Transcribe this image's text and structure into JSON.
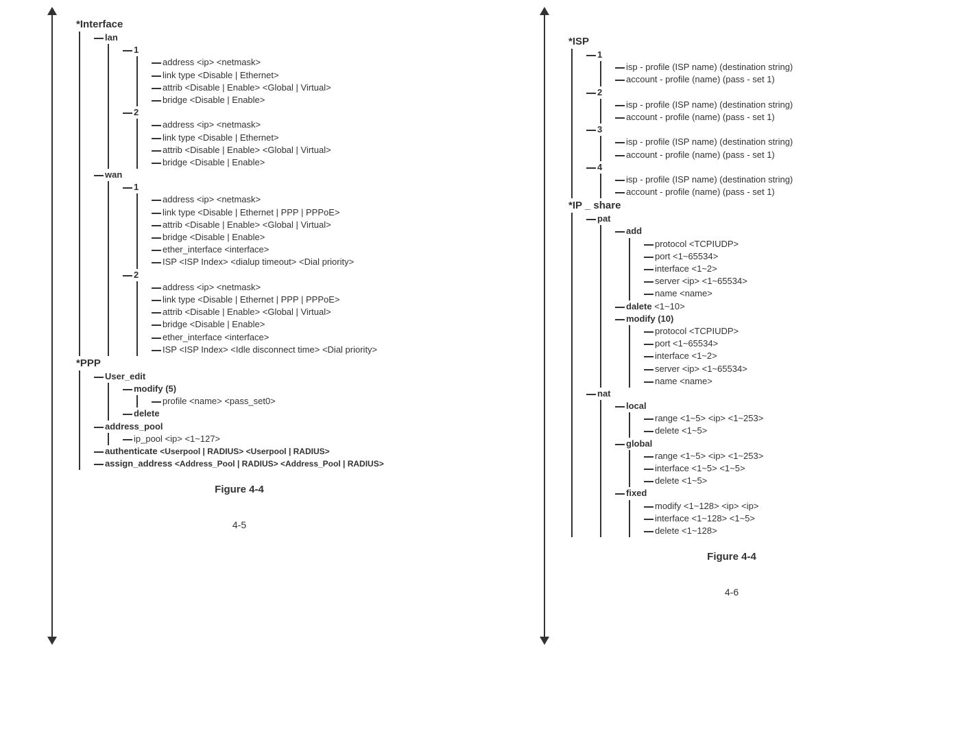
{
  "left": {
    "interface": {
      "label": "*Interface",
      "lan": {
        "label": "lan",
        "n1": {
          "label": "1",
          "a": "address <ip> <netmask>",
          "b": "link type <Disable | Ethernet>",
          "c": "attrib <Disable | Enable> <Global | Virtual>",
          "d": "bridge <Disable | Enable>"
        },
        "n2": {
          "label": "2",
          "a": "address <ip> <netmask>",
          "b": "link type <Disable | Ethernet>",
          "c": "attrib <Disable | Enable> <Global | Virtual>",
          "d": "bridge <Disable | Enable>"
        }
      },
      "wan": {
        "label": "wan",
        "n1": {
          "label": "1",
          "a": "address <ip> <netmask>",
          "b": "link type <Disable | Ethernet | PPP | PPPoE>",
          "c": "attrib <Disable | Enable> <Global | Virtual>",
          "d": "bridge <Disable | Enable>",
          "e": "ether_interface <interface>",
          "f": "ISP <ISP Index> <dialup timeout> <Dial priority>"
        },
        "n2": {
          "label": "2",
          "a": "address <ip> <netmask>",
          "b": "link type <Disable | Ethernet | PPP | PPPoE>",
          "c": "attrib <Disable | Enable> <Global | Virtual>",
          "d": "bridge <Disable | Enable>",
          "e": "ether_interface <interface>",
          "f": "ISP <ISP Index> <Idle disconnect time> <Dial priority>"
        }
      }
    },
    "ppp": {
      "label": "*PPP",
      "user_edit": {
        "label": "User_edit",
        "modify": {
          "label": "modify (5)",
          "a": "profile <name> <pass_set0>"
        },
        "del": "delete"
      },
      "address_pool": {
        "label": "address_pool",
        "a": "ip_pool <ip> <1~127>"
      },
      "authenticate": {
        "label": "authenticate",
        "args": "<Userpool | RADIUS> <Userpool | RADIUS>"
      },
      "assign_address": {
        "label": "assign_address",
        "args": "<Address_Pool | RADIUS> <Address_Pool | RADIUS>"
      }
    },
    "figure": "Figure 4-4",
    "page": "4-5"
  },
  "right": {
    "isp": {
      "label": "*ISP",
      "n1": {
        "label": "1",
        "a": "isp - profile (ISP name) (destination string)",
        "b": "account - profile (name) (pass - set 1)"
      },
      "n2": {
        "label": "2",
        "a": "isp - profile (ISP name) (destination string)",
        "b": "account - profile (name) (pass - set 1)"
      },
      "n3": {
        "label": "3",
        "a": "isp - profile (ISP name) (destination string)",
        "b": "account - profile (name) (pass - set 1)"
      },
      "n4": {
        "label": "4",
        "a": "isp - profile (ISP name) (destination string)",
        "b": "account - profile (name) (pass - set 1)"
      }
    },
    "ipshare": {
      "label": "*IP _ share",
      "pat": {
        "label": "pat",
        "add": {
          "label": "add",
          "a": "protocol <TCPIUDP>",
          "b": "port <1~65534>",
          "c": "interface <1~2>",
          "d": "server <ip> <1~65534>",
          "e": "name <name>"
        },
        "dalete": {
          "label": "dalete",
          "args": "<1~10>"
        },
        "modify": {
          "label": "modify (10)",
          "a": "protocol <TCPIUDP>",
          "b": "port <1~65534>",
          "c": "interface <1~2>",
          "d": "server <ip> <1~65534>",
          "e": "name <name>"
        }
      },
      "nat": {
        "label": "nat",
        "local": {
          "label": "local",
          "a": "range <1~5> <ip> <1~253>",
          "b": "delete <1~5>"
        },
        "global": {
          "label": "global",
          "a": "range <1~5> <ip> <1~253>",
          "b": "interface <1~5> <1~5>",
          "c": "delete <1~5>"
        },
        "fixed": {
          "label": "fixed",
          "a": "modify <1~128> <ip> <ip>",
          "b": "interface <1~128> <1~5>",
          "c": "delete <1~128>"
        }
      }
    },
    "figure": "Figure 4-4",
    "page": "4-6"
  }
}
